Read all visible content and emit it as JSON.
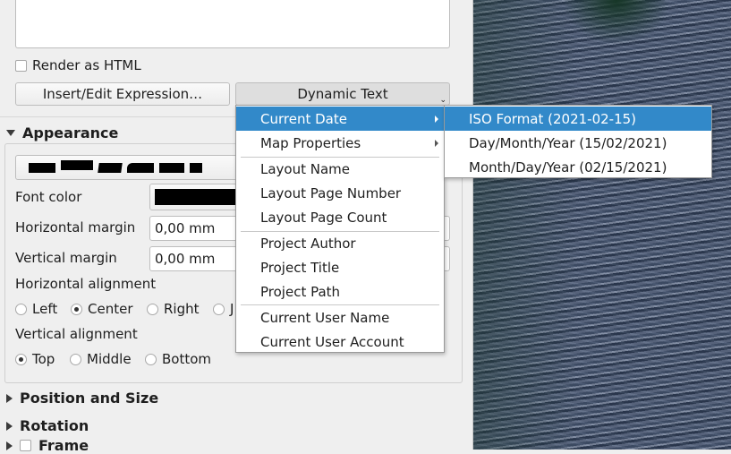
{
  "html_section": {
    "render_as_html": "Render as HTML",
    "insert_expression_button": "Insert/Edit Expression…",
    "dynamic_text_button": "Dynamic Text"
  },
  "appearance": {
    "title": "Appearance",
    "font_color_label": "Font color",
    "horizontal_margin_label": "Horizontal margin",
    "horizontal_margin_value": "0,00 mm",
    "vertical_margin_label": "Vertical margin",
    "vertical_margin_value": "0,00 mm",
    "halign_label": "Horizontal alignment",
    "halign_options": [
      "Left",
      "Center",
      "Right",
      "J"
    ],
    "halign_selected": "Center",
    "valign_label": "Vertical alignment",
    "valign_options": [
      "Top",
      "Middle",
      "Bottom"
    ],
    "valign_selected": "Top"
  },
  "sections": {
    "position_size": "Position and Size",
    "rotation": "Rotation",
    "frame": "Frame"
  },
  "dynamic_menu": {
    "items": [
      "Current Date",
      "Map Properties",
      "Layout Name",
      "Layout Page Number",
      "Layout Page Count",
      "Project Author",
      "Project Title",
      "Project Path",
      "Current User Name",
      "Current User Account"
    ]
  },
  "date_submenu": {
    "items": [
      "ISO Format (2021-02-15)",
      "Day/Month/Year (15/02/2021)",
      "Month/Day/Year (02/15/2021)"
    ]
  },
  "colors": {
    "selection": "#3289c9"
  }
}
